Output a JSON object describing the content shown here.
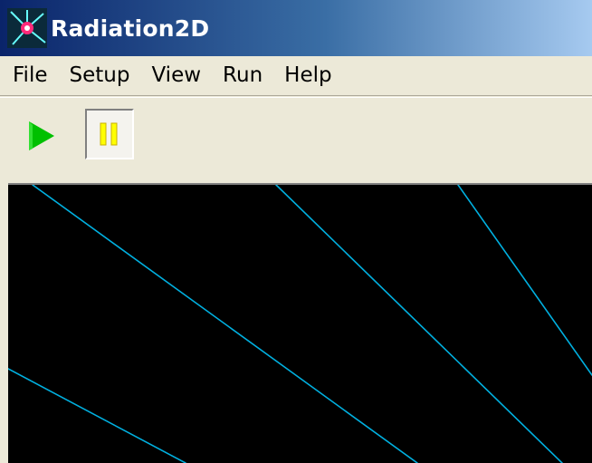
{
  "window": {
    "title": "Radiation2D",
    "icon": "radiation-app-icon"
  },
  "menubar": {
    "items": [
      {
        "label": "File"
      },
      {
        "label": "Setup"
      },
      {
        "label": "View"
      },
      {
        "label": "Run"
      },
      {
        "label": "Help"
      }
    ]
  },
  "toolbar": {
    "buttons": [
      {
        "icon": "play-icon",
        "color": "#00c000",
        "pressed": false
      },
      {
        "icon": "pause-icon",
        "color": "#ffff00",
        "pressed": true
      }
    ]
  },
  "canvas": {
    "background": "#000000",
    "line_color": "#00b0e0"
  }
}
